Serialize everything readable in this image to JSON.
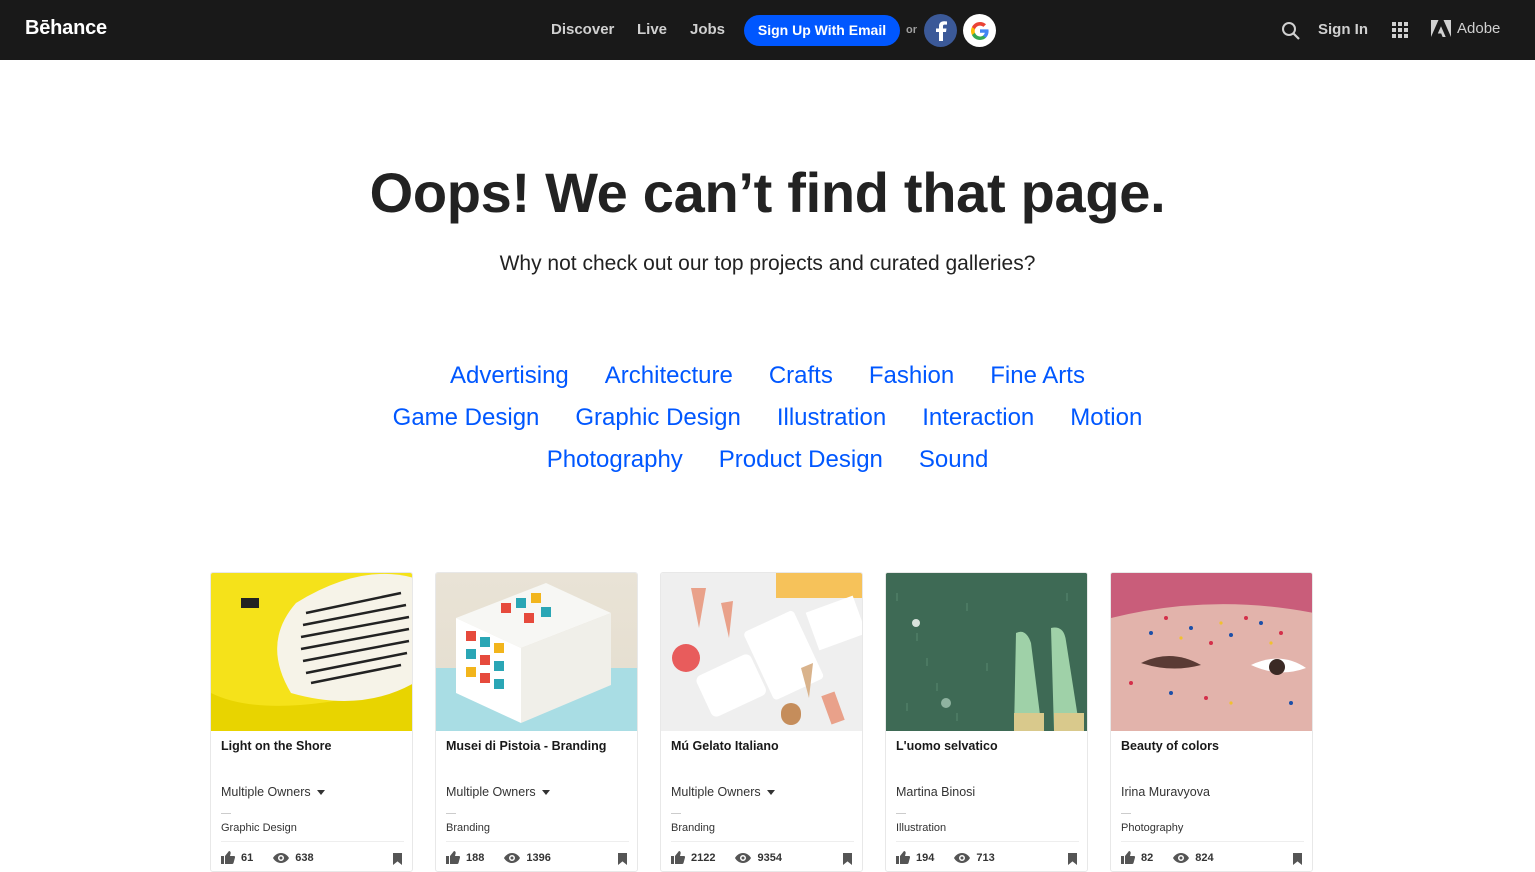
{
  "nav": {
    "logo": "Bēhance",
    "links": [
      "Discover",
      "Live",
      "Jobs"
    ],
    "signup_label": "Sign Up With Email",
    "or_label": "or",
    "signin_label": "Sign In",
    "adobe_label": "Adobe"
  },
  "hero": {
    "title": "Oops! We can’t find that page.",
    "subtitle": "Why not check out our top projects and curated galleries?"
  },
  "categories": {
    "row1": [
      "Advertising",
      "Architecture",
      "Crafts",
      "Fashion",
      "Fine Arts"
    ],
    "row2": [
      "Game Design",
      "Graphic Design",
      "Illustration",
      "Interaction",
      "Motion"
    ],
    "row3": [
      "Photography",
      "Product Design",
      "Sound"
    ]
  },
  "cards": [
    {
      "title": "Light on the Shore",
      "owner": "Multiple Owners",
      "owner_dropdown": true,
      "field": "Graphic Design",
      "likes": "61",
      "views": "638"
    },
    {
      "title": "Musei di Pistoia - Branding",
      "owner": "Multiple Owners",
      "owner_dropdown": true,
      "field": "Branding",
      "likes": "188",
      "views": "1396"
    },
    {
      "title": "Mú Gelato Italiano",
      "owner": "Multiple Owners",
      "owner_dropdown": true,
      "field": "Branding",
      "likes": "2122",
      "views": "9354"
    },
    {
      "title": "L'uomo selvatico",
      "owner": "Martina Binosi",
      "owner_dropdown": false,
      "field": "Illustration",
      "likes": "194",
      "views": "713"
    },
    {
      "title": "Beauty of colors",
      "owner": "Irina Muravyova",
      "owner_dropdown": false,
      "field": "Photography",
      "likes": "82",
      "views": "824"
    }
  ],
  "colors": {
    "nav_bg": "#191919",
    "accent_blue": "#0057ff",
    "facebook": "#3b5998"
  },
  "icons": [
    "facebook-icon",
    "google-icon",
    "search-icon",
    "apps-grid-icon",
    "adobe-logo-icon",
    "like-icon",
    "views-eye-icon",
    "bookmark-icon"
  ]
}
